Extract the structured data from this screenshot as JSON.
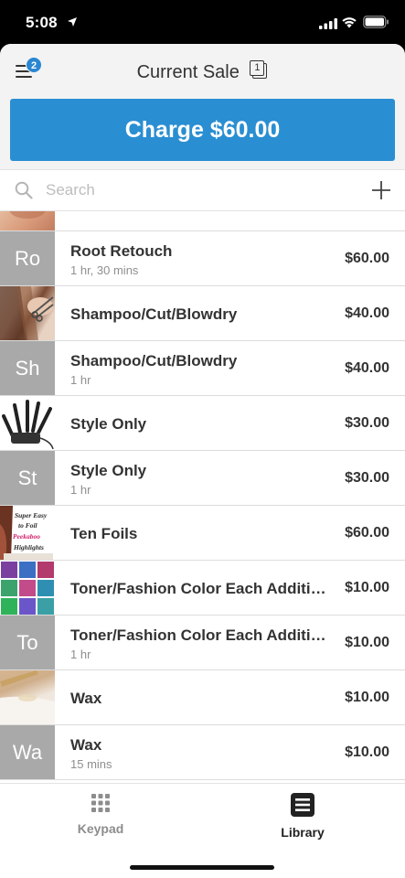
{
  "status_bar": {
    "time": "5:08",
    "icons": [
      "location-arrow-icon",
      "cellular-signal-icon",
      "wifi-icon",
      "battery-icon"
    ]
  },
  "header": {
    "title": "Current Sale",
    "menu_badge": "2",
    "ticket_count": "1",
    "icons": [
      "menu-icon",
      "ticket-icon"
    ]
  },
  "charge": {
    "label": "Charge $60.00",
    "color": "#2a8ed2"
  },
  "search": {
    "placeholder": "Search",
    "value": "",
    "icons": [
      "search-icon",
      "plus-icon"
    ]
  },
  "items": [
    {
      "name": "Root Retouch",
      "detail": "1 hr, 30 mins",
      "price": "$60.00",
      "thumb": "Ro"
    },
    {
      "name": "Shampoo/Cut/Blowdry",
      "detail": "",
      "price": "$40.00",
      "thumb": ""
    },
    {
      "name": "Shampoo/Cut/Blowdry",
      "detail": "1 hr",
      "price": "$40.00",
      "thumb": "Sh"
    },
    {
      "name": "Style Only",
      "detail": "",
      "price": "$30.00",
      "thumb": ""
    },
    {
      "name": "Style Only",
      "detail": "1 hr",
      "price": "$30.00",
      "thumb": "St"
    },
    {
      "name": "Ten Foils",
      "detail": "",
      "price": "$60.00",
      "thumb": "",
      "thumb_text": [
        "Super Easy",
        "to Foil",
        "Peekaboo",
        "Highlights"
      ]
    },
    {
      "name": "Toner/Fashion Color Each Additio...",
      "detail": "",
      "price": "$10.00",
      "thumb": ""
    },
    {
      "name": "Toner/Fashion Color Each Additio...",
      "detail": "1 hr",
      "price": "$10.00",
      "thumb": "To"
    },
    {
      "name": "Wax",
      "detail": "",
      "price": "$10.00",
      "thumb": ""
    },
    {
      "name": "Wax",
      "detail": "15 mins",
      "price": "$10.00",
      "thumb": "Wa"
    }
  ],
  "tabbar": {
    "keypad": {
      "label": "Keypad",
      "icon": "keypad-icon"
    },
    "library": {
      "label": "Library",
      "icon": "library-icon"
    },
    "active": "library"
  },
  "colors": {
    "accent": "#2a8ed2",
    "badge": "#2a86d1",
    "thumb_placeholder": "#a9a9a9"
  }
}
